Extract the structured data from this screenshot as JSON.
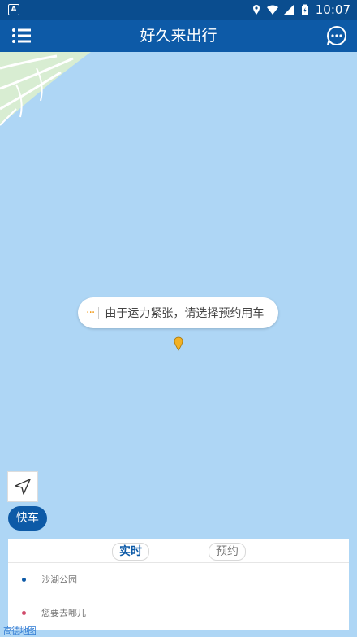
{
  "status_bar": {
    "time": "10:07",
    "left_badge": "A"
  },
  "header": {
    "title": "好久来出行",
    "menu_icon": "list-icon",
    "message_icon": "chat-icon"
  },
  "map": {
    "notice": {
      "dots": "···",
      "text": "由于运力紧张，请选择预约用车"
    },
    "express_label": "快车",
    "logo_text": "高德地图"
  },
  "panel": {
    "tabs": [
      {
        "label": "实时",
        "active": true
      },
      {
        "label": "预约",
        "active": false
      }
    ],
    "start_location": "沙湖公园",
    "destination_placeholder": "您要去哪儿"
  },
  "colors": {
    "primary": "#0d5aa7",
    "water": "#aed6f5",
    "accent": "#f29b1a"
  }
}
